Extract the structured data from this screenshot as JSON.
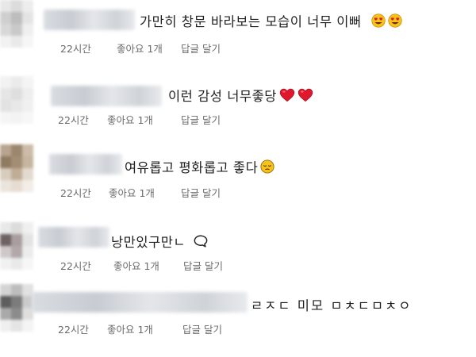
{
  "comments": [
    {
      "text": "가만히 창문 바라보는 모습이 너무 이뻐",
      "emoji": [
        "heart-eyes-emoji",
        "heart-eyes-emoji"
      ],
      "time": "22시간",
      "likes": "좋아요 1개",
      "reply": "답글 달기"
    },
    {
      "text": "이런 감성 너무좋당",
      "emoji": [
        "red-heart-emoji",
        "red-heart-emoji"
      ],
      "time": "22시간",
      "likes": "좋아요 1개",
      "reply": "답글 달기"
    },
    {
      "text": "여유롭고 평화롭고 좋다",
      "emoji": [
        "pensive-face-emoji"
      ],
      "time": "22시간",
      "likes": "좋아요 1개",
      "reply": "답글 달기"
    },
    {
      "text": "낭만있구만ㄴ",
      "emoji": [
        "speech-bubble-icon"
      ],
      "time": "22시간",
      "likes": "좋아요 1개",
      "reply": "답글 달기"
    },
    {
      "text": "ㄹㅈㄷ 미모 ㅁㅊㄷㅁㅊㅇ",
      "emoji": [],
      "time": "22시간",
      "likes": "좋아요 1개",
      "reply": "답글 달기"
    }
  ],
  "colors": {
    "meta_text": "#6b6b6b",
    "comment_text": "#1f1f1f",
    "heart": "#e0182d",
    "emoji_face": "#f7c21b"
  }
}
